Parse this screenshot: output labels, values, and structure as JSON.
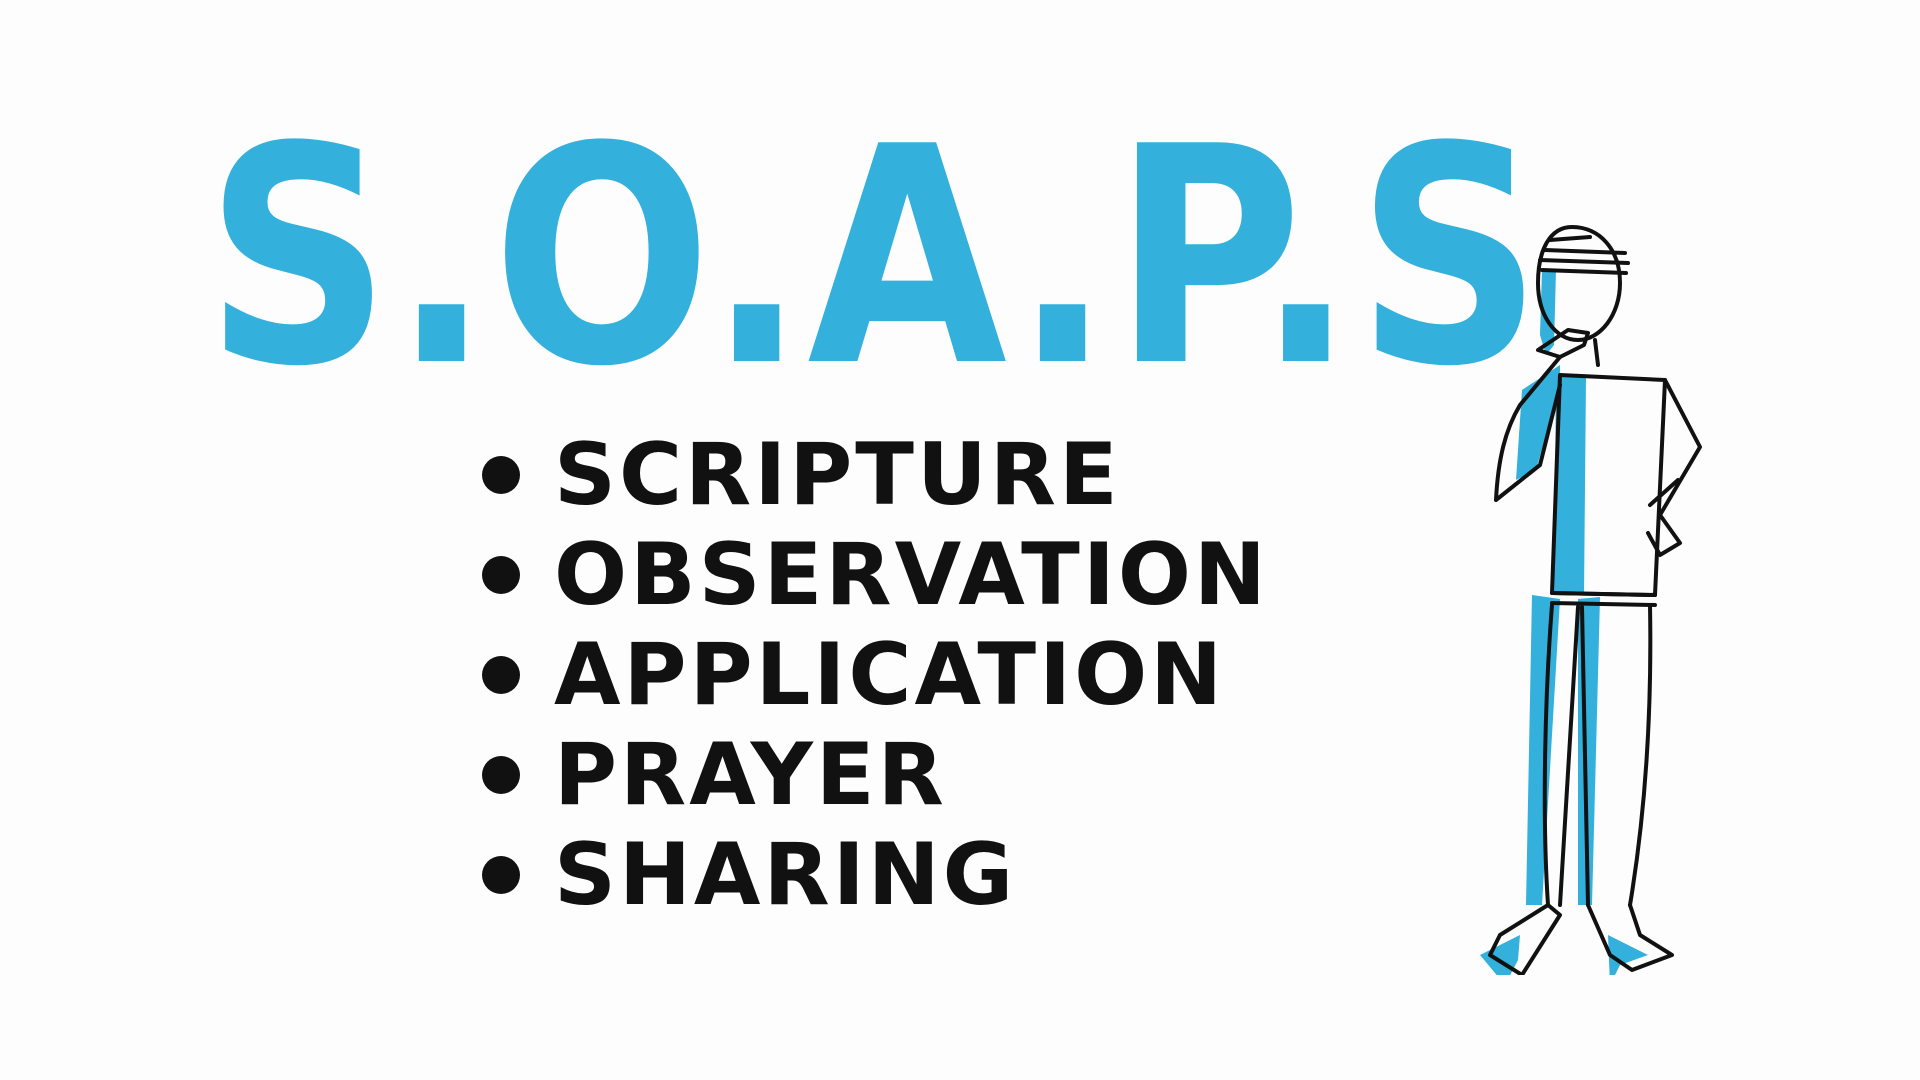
{
  "title": "S.O.A.P.S",
  "items": [
    {
      "label": "SCRIPTURE"
    },
    {
      "label": "OBSERVATION"
    },
    {
      "label": "APPLICATION"
    },
    {
      "label": "PRAYER"
    },
    {
      "label": "SHARING"
    }
  ],
  "colors": {
    "accent": "#33b0dc",
    "ink": "#111111",
    "background": "#fdfdfd"
  },
  "figure": {
    "icon": "thinking-stick-figure"
  }
}
